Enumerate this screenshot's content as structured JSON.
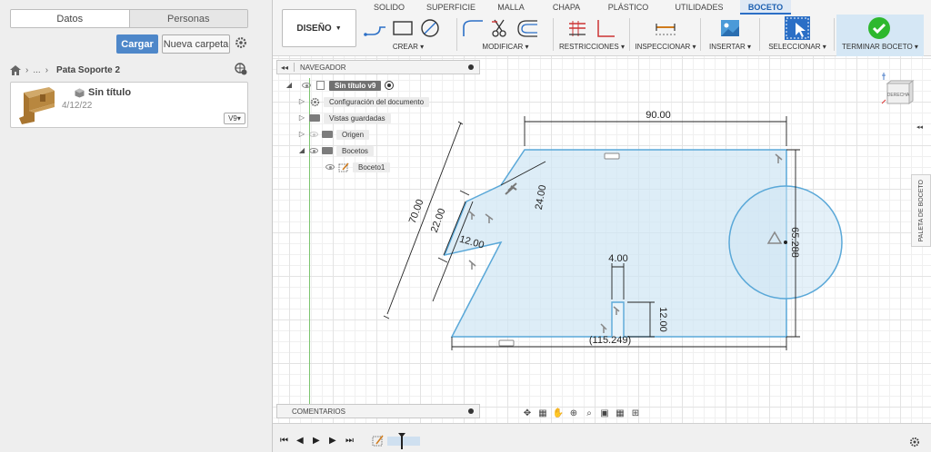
{
  "data_panel": {
    "tabs": [
      {
        "label": "Datos",
        "active": true
      },
      {
        "label": "Personas",
        "active": false
      }
    ],
    "upload_label": "Cargar",
    "new_folder_label": "Nueva carpeta",
    "breadcrumb": {
      "ellipsis": "...",
      "title": "Pata Soporte 2"
    },
    "file": {
      "name": "Sin título",
      "date": "4/12/22",
      "version": "V9▾"
    }
  },
  "toolbar": {
    "workspace_label": "DISEÑO",
    "tabs": [
      "SOLIDO",
      "SUPERFICIE",
      "MALLA",
      "CHAPA",
      "PLÁSTICO",
      "UTILIDADES",
      "BOCETO"
    ],
    "active_tab": "BOCETO",
    "groups": {
      "create": "CREAR",
      "modify": "MODIFICAR",
      "constraints": "RESTRICCIONES",
      "inspect": "INSPECCIONAR",
      "insert": "INSERTAR",
      "select": "SELECCIONAR",
      "finish": "TERMINAR BOCETO"
    }
  },
  "browser": {
    "title": "NAVEGADOR",
    "root": "Sin título v9",
    "items": [
      "Configuración del documento",
      "Vistas guardadas",
      "Origen",
      "Bocetos",
      "Boceto1"
    ],
    "comments": "COMENTARIOS"
  },
  "viewcube_label": "DERECHA",
  "palette_label": "PALETA DE BOCETO",
  "dimensions": {
    "top": "90.00",
    "slant": "70.00",
    "pocket_height": "22.00",
    "pocket_width": "12.00",
    "edge_offset": "24.00",
    "slot_width": "4.00",
    "slot_height": "12.00",
    "circle_diameter": "65.288",
    "bottom": "(115.249)"
  },
  "colors": {
    "accent_blue": "#2b6fc6",
    "sketch_line": "#5aa8d8",
    "sketch_fill": "#cfe6f4",
    "finish_green": "#2eb82e"
  }
}
